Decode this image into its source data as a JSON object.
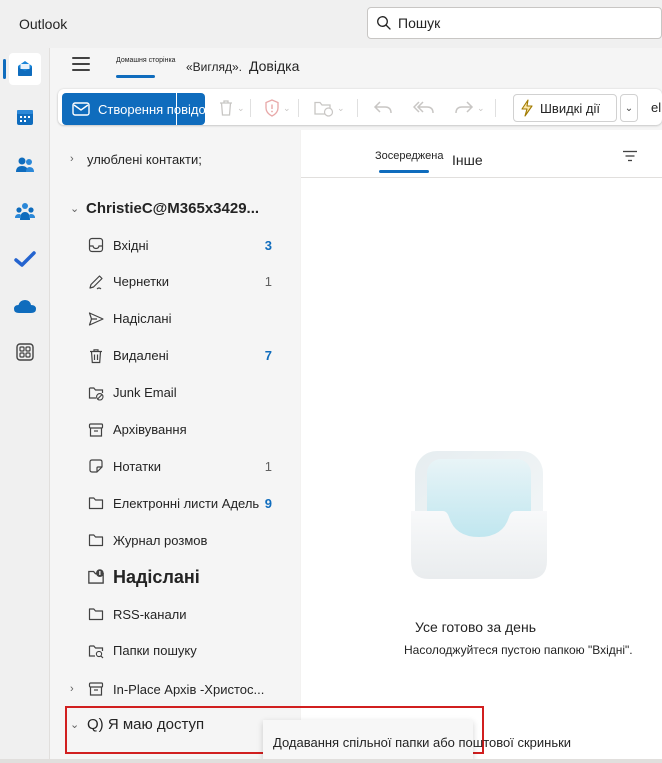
{
  "app": {
    "title": "Outlook"
  },
  "search": {
    "placeholder": "Пошук"
  },
  "rail": {
    "items": [
      {
        "name": "mail",
        "icon": "mail-icon",
        "active": true
      },
      {
        "name": "calendar",
        "icon": "calendar-icon"
      },
      {
        "name": "people",
        "icon": "people-icon"
      },
      {
        "name": "groups",
        "icon": "groups-icon"
      },
      {
        "name": "todo",
        "icon": "checkmark-icon"
      },
      {
        "name": "onedrive",
        "icon": "cloud-icon"
      },
      {
        "name": "apps",
        "icon": "apps-icon"
      }
    ]
  },
  "ribbon": {
    "tabs": {
      "home": "Домашня сторінка",
      "view": "«Вигляд».",
      "help": "Довідка"
    },
    "new_mail_label": "Створення повідомлення",
    "quick_steps_label": "Швидкі дії",
    "overflow_label": "el"
  },
  "folders": {
    "favorites_label": "улюблені контакти;",
    "account_label": "ChristieC@M365x3429...",
    "items": [
      {
        "label": "Вхідні",
        "icon": "inbox-icon",
        "count": "3",
        "count_bold": true
      },
      {
        "label": "Чернетки",
        "icon": "drafts-icon",
        "count": "1"
      },
      {
        "label": "Надіслані",
        "icon": "sent-icon",
        "count": ""
      },
      {
        "label": "Видалені",
        "icon": "trash-icon",
        "count": "7",
        "count_bold": true
      },
      {
        "label": "Junk Email",
        "icon": "junk-folder-icon",
        "count": ""
      },
      {
        "label": "Архівування",
        "icon": "archive-icon",
        "count": ""
      },
      {
        "label": "Нотатки",
        "icon": "notes-icon",
        "count": "1"
      },
      {
        "label": "Електронні листи Адель",
        "icon": "folder-icon",
        "count": "9",
        "count_bold": true
      },
      {
        "label": "Журнал розмов",
        "icon": "folder-icon",
        "count": ""
      },
      {
        "label": "Надіслані",
        "icon": "outbox-icon",
        "count": "",
        "large": true
      },
      {
        "label": "RSS-канали",
        "icon": "folder-icon",
        "count": ""
      },
      {
        "label": "Папки пошуку",
        "icon": "search-folder-icon",
        "count": ""
      }
    ],
    "archive_label": "In-Place Архів -Христос...",
    "shared_label": "Q) Я маю доступ"
  },
  "message_list": {
    "tab_focused": "Зосереджена",
    "tab_other": "Інше",
    "empty_title": "Усе готово за день",
    "empty_subtitle": "Насолоджуйтеся пустою папкою \"Вхідні\"."
  },
  "tooltip": {
    "text": "Додавання спільної папки або поштової скриньки"
  },
  "colors": {
    "accent": "#0f6cbd",
    "highlight": "#d11f1f"
  }
}
